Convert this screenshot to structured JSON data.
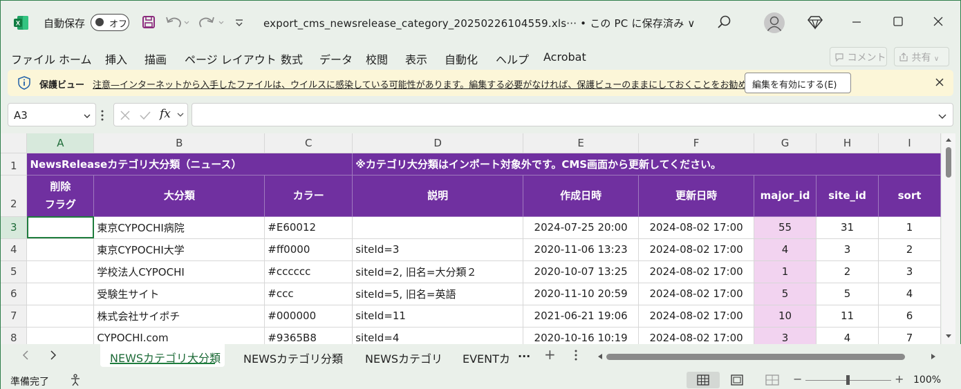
{
  "titlebar": {
    "autosave_label": "自動保存",
    "autosave_state": "オフ",
    "doc_title": "export_cms_newsrelease_category_20250226104559.xls··· • この PC に保存済み ∨"
  },
  "ribbon": {
    "tabs": [
      "ファイル",
      "ホーム",
      "挿入",
      "描画",
      "ページ レイアウト",
      "数式",
      "データ",
      "校閲",
      "表示",
      "自動化",
      "ヘルプ",
      "Acrobat"
    ],
    "comment_label": "コメント",
    "share_label": "共有"
  },
  "protected_view": {
    "title": "保護ビュー",
    "message": "注意—インターネットから入手したファイルは、ウイルスに感染している可能性があります。編集する必要がなければ、保護ビューのままにしておくことをお勧めします。",
    "enable_button": "編集を有効にする(E)"
  },
  "formula_bar": {
    "name_box": "A3",
    "fx": "fx",
    "formula": ""
  },
  "grid": {
    "columns": [
      "A",
      "B",
      "C",
      "D",
      "E",
      "F",
      "G",
      "H",
      "I"
    ],
    "row1": {
      "num": "1",
      "title": "NewsReleaseカテゴリ大分類（ニュース）",
      "note": "※カテゴリ大分類はインポート対象外です。CMS画面から更新してください。"
    },
    "row2": {
      "num": "2",
      "headers": [
        "削除\nフラグ",
        "大分類",
        "カラー",
        "説明",
        "作成日時",
        "更新日時",
        "major_id",
        "site_id",
        "sort"
      ]
    },
    "rows": [
      {
        "num": "3",
        "cells": [
          "",
          "東京CYPOCHI病院",
          "#E60012",
          "",
          "2024-07-25 20:00",
          "2024-08-02 17:00",
          "55",
          "31",
          "1"
        ]
      },
      {
        "num": "4",
        "cells": [
          "",
          "東京CYPOCHI大学",
          "#ff0000",
          "siteId=3",
          "2020-11-06 13:23",
          "2024-08-02 17:00",
          "4",
          "3",
          "2"
        ]
      },
      {
        "num": "5",
        "cells": [
          "",
          "学校法人CYPOCHI",
          "#cccccc",
          "siteId=2, 旧名=大分類２",
          "2020-10-07 13:25",
          "2024-08-02 17:00",
          "1",
          "2",
          "3"
        ]
      },
      {
        "num": "6",
        "cells": [
          "",
          "受験生サイト",
          "#ccc",
          "siteId=5, 旧名=英語",
          "2020-11-10 20:59",
          "2024-08-02 17:00",
          "5",
          "5",
          "4"
        ]
      },
      {
        "num": "7",
        "cells": [
          "",
          "株式会社サイポチ",
          "#000000",
          "siteId=11",
          "2021-06-21 19:06",
          "2024-08-02 17:00",
          "10",
          "11",
          "6"
        ]
      },
      {
        "num": "8",
        "cells": [
          "",
          "CYPOCHI.com",
          "#9365B8",
          "siteId=4",
          "2020-10-16 10:19",
          "2024-08-02 17:00",
          "3",
          "4",
          "7"
        ]
      }
    ]
  },
  "sheets": {
    "active": "NEWSカテゴリ大分類",
    "others": [
      "NEWSカテゴリ分類",
      "NEWSカテゴリ",
      "EVENTカ"
    ],
    "more": "···"
  },
  "status": {
    "ready": "準備完了",
    "zoom": "100%"
  },
  "colors": {
    "header_purple": "#7030a0",
    "id_highlight": "#f2d3f0",
    "accent_green": "#1e7d3d"
  }
}
